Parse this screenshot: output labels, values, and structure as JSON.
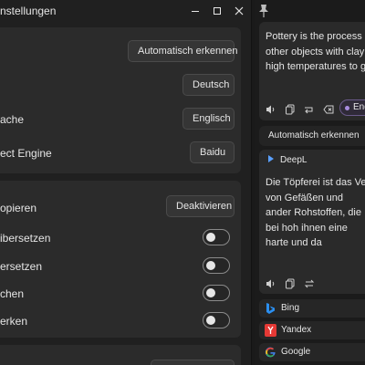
{
  "settings_window": {
    "title": "nstellungen",
    "controls": {
      "minimize_icon": "minimize-icon",
      "maximize_icon": "maximize-icon",
      "close_icon": "close-icon"
    }
  },
  "general_card": {
    "rows": [
      {
        "label": "",
        "button": "Automatisch erkennen"
      },
      {
        "label": "",
        "button": "Deutsch"
      },
      {
        "label": "ache",
        "button": "Englisch"
      },
      {
        "label": "ect Engine",
        "button": "Baidu"
      }
    ]
  },
  "options_card": {
    "copy_row": {
      "label": "opieren",
      "button": "Deaktivieren"
    },
    "toggles": [
      {
        "label": "ibersetzen",
        "on": false
      },
      {
        "label": "ersetzen",
        "on": false
      },
      {
        "label": "chen",
        "on": false
      },
      {
        "label": "erken",
        "on": false
      }
    ]
  },
  "translator": {
    "pin_icon": "pin-icon",
    "source_text": "Pottery is the process a other objects with clay high temperatures to g",
    "source_lang_chip": "Engli",
    "detect_label": "Automatisch erkennen",
    "result_engine": "DeepL",
    "result_text": "Die Töpferei ist das Ver von Gefäßen und ander Rohstoffen, die bei hoh ihnen eine harte und da",
    "engines": [
      {
        "name": "Bing",
        "icon": "bing-icon"
      },
      {
        "name": "Yandex",
        "icon": "yandex-icon"
      },
      {
        "name": "Google",
        "icon": "google-icon"
      }
    ]
  },
  "colors": {
    "window_bg": "#202020",
    "card_bg": "#2b2b2b",
    "accent": "#a88cdf"
  }
}
